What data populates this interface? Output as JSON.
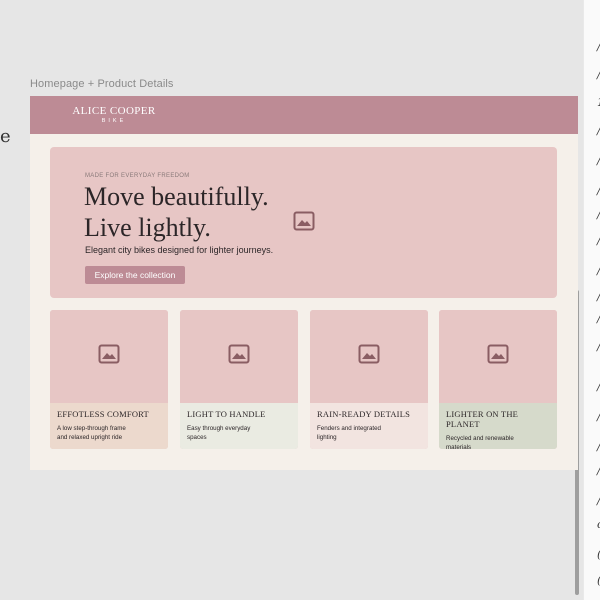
{
  "canvas": {
    "label": "Homepage + Product Details",
    "left_fragment": "e",
    "right_fragments": [
      "/",
      "/",
      "1",
      "/",
      "/",
      "/",
      "/",
      "/",
      "/",
      "/",
      "/",
      "/",
      "/",
      "/",
      "/",
      "/",
      "/",
      "c",
      "(",
      "(",
      "(",
      "(",
      "(",
      "(",
      "("
    ]
  },
  "header": {
    "brand_name": "ALICE COOPER",
    "brand_sub": "BIKE"
  },
  "hero": {
    "eyebrow": "MADE FOR EVERYDAY FREEDOM",
    "headline_line1": "Move beautifully.",
    "headline_line2": "Live lightly.",
    "tagline": "Elegant city bikes designed for lighter journeys.",
    "cta_label": "Explore the collection",
    "image_icon": "image-placeholder-icon"
  },
  "cards": [
    {
      "title": "EFFOTLESS COMFORT",
      "desc_line1": "A low step-through frame",
      "desc_line2": "and relaxed upright ride",
      "color": "#ecd9cd"
    },
    {
      "title": "LIGHT TO HANDLE",
      "desc_line1": "Easy through everyday",
      "desc_line2": "spaces",
      "color": "#eaebe2"
    },
    {
      "title": "RAIN-READY DETAILS",
      "desc_line1": "Fenders and integrated",
      "desc_line2": "lighting",
      "color": "#f2e4e0"
    },
    {
      "title": "LIGHTER ON THE PLANET",
      "desc_line1": "Recycled and renewable",
      "desc_line2": "materials",
      "color": "#d6dacb"
    }
  ],
  "colors": {
    "accent": "#bd8b95",
    "hero_bg": "#e7c6c5",
    "page_bg": "#f5f0ea",
    "icon": "#8a5d63"
  }
}
